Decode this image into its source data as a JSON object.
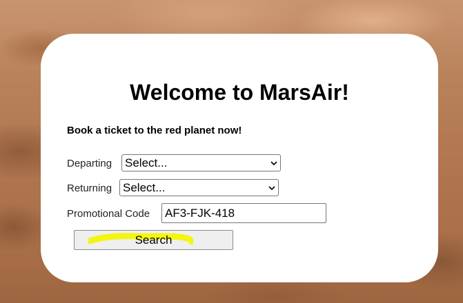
{
  "colors": {
    "background": "#b07650",
    "card": "#ffffff",
    "highlight": "#f3f500",
    "button": "#efefef"
  },
  "header": {
    "title": "Welcome to MarsAir!",
    "tagline": "Book a ticket to the red planet now!"
  },
  "form": {
    "departing": {
      "label": "Departing",
      "selected": "Select..."
    },
    "returning": {
      "label": "Returning",
      "selected": "Select..."
    },
    "promo": {
      "label": "Promotional Code",
      "value": "AF3-FJK-418"
    },
    "search_label": "Search"
  },
  "icons": {
    "select_arrow": "chevron-down-icon"
  }
}
